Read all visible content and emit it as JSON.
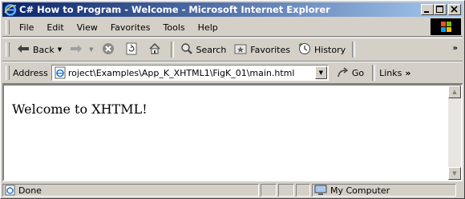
{
  "window": {
    "title": "C# How to Program - Welcome - Microsoft Internet Explorer",
    "title_color": "#0a246a"
  },
  "menu": {
    "items": [
      "File",
      "Edit",
      "View",
      "Favorites",
      "Tools",
      "Help"
    ]
  },
  "toolbar": {
    "back_label": "Back",
    "search_label": "Search",
    "favorites_label": "Favorites",
    "history_label": "History",
    "overflow": "»"
  },
  "address": {
    "label": "Address",
    "value": "roject\\Examples\\App_K_XHTML1\\FigK_01\\main.html",
    "go_label": "Go",
    "links_label": "Links",
    "links_overflow": "»"
  },
  "page": {
    "text": "Welcome to XHTML!"
  },
  "status": {
    "text": "Done",
    "zone": "My Computer"
  }
}
